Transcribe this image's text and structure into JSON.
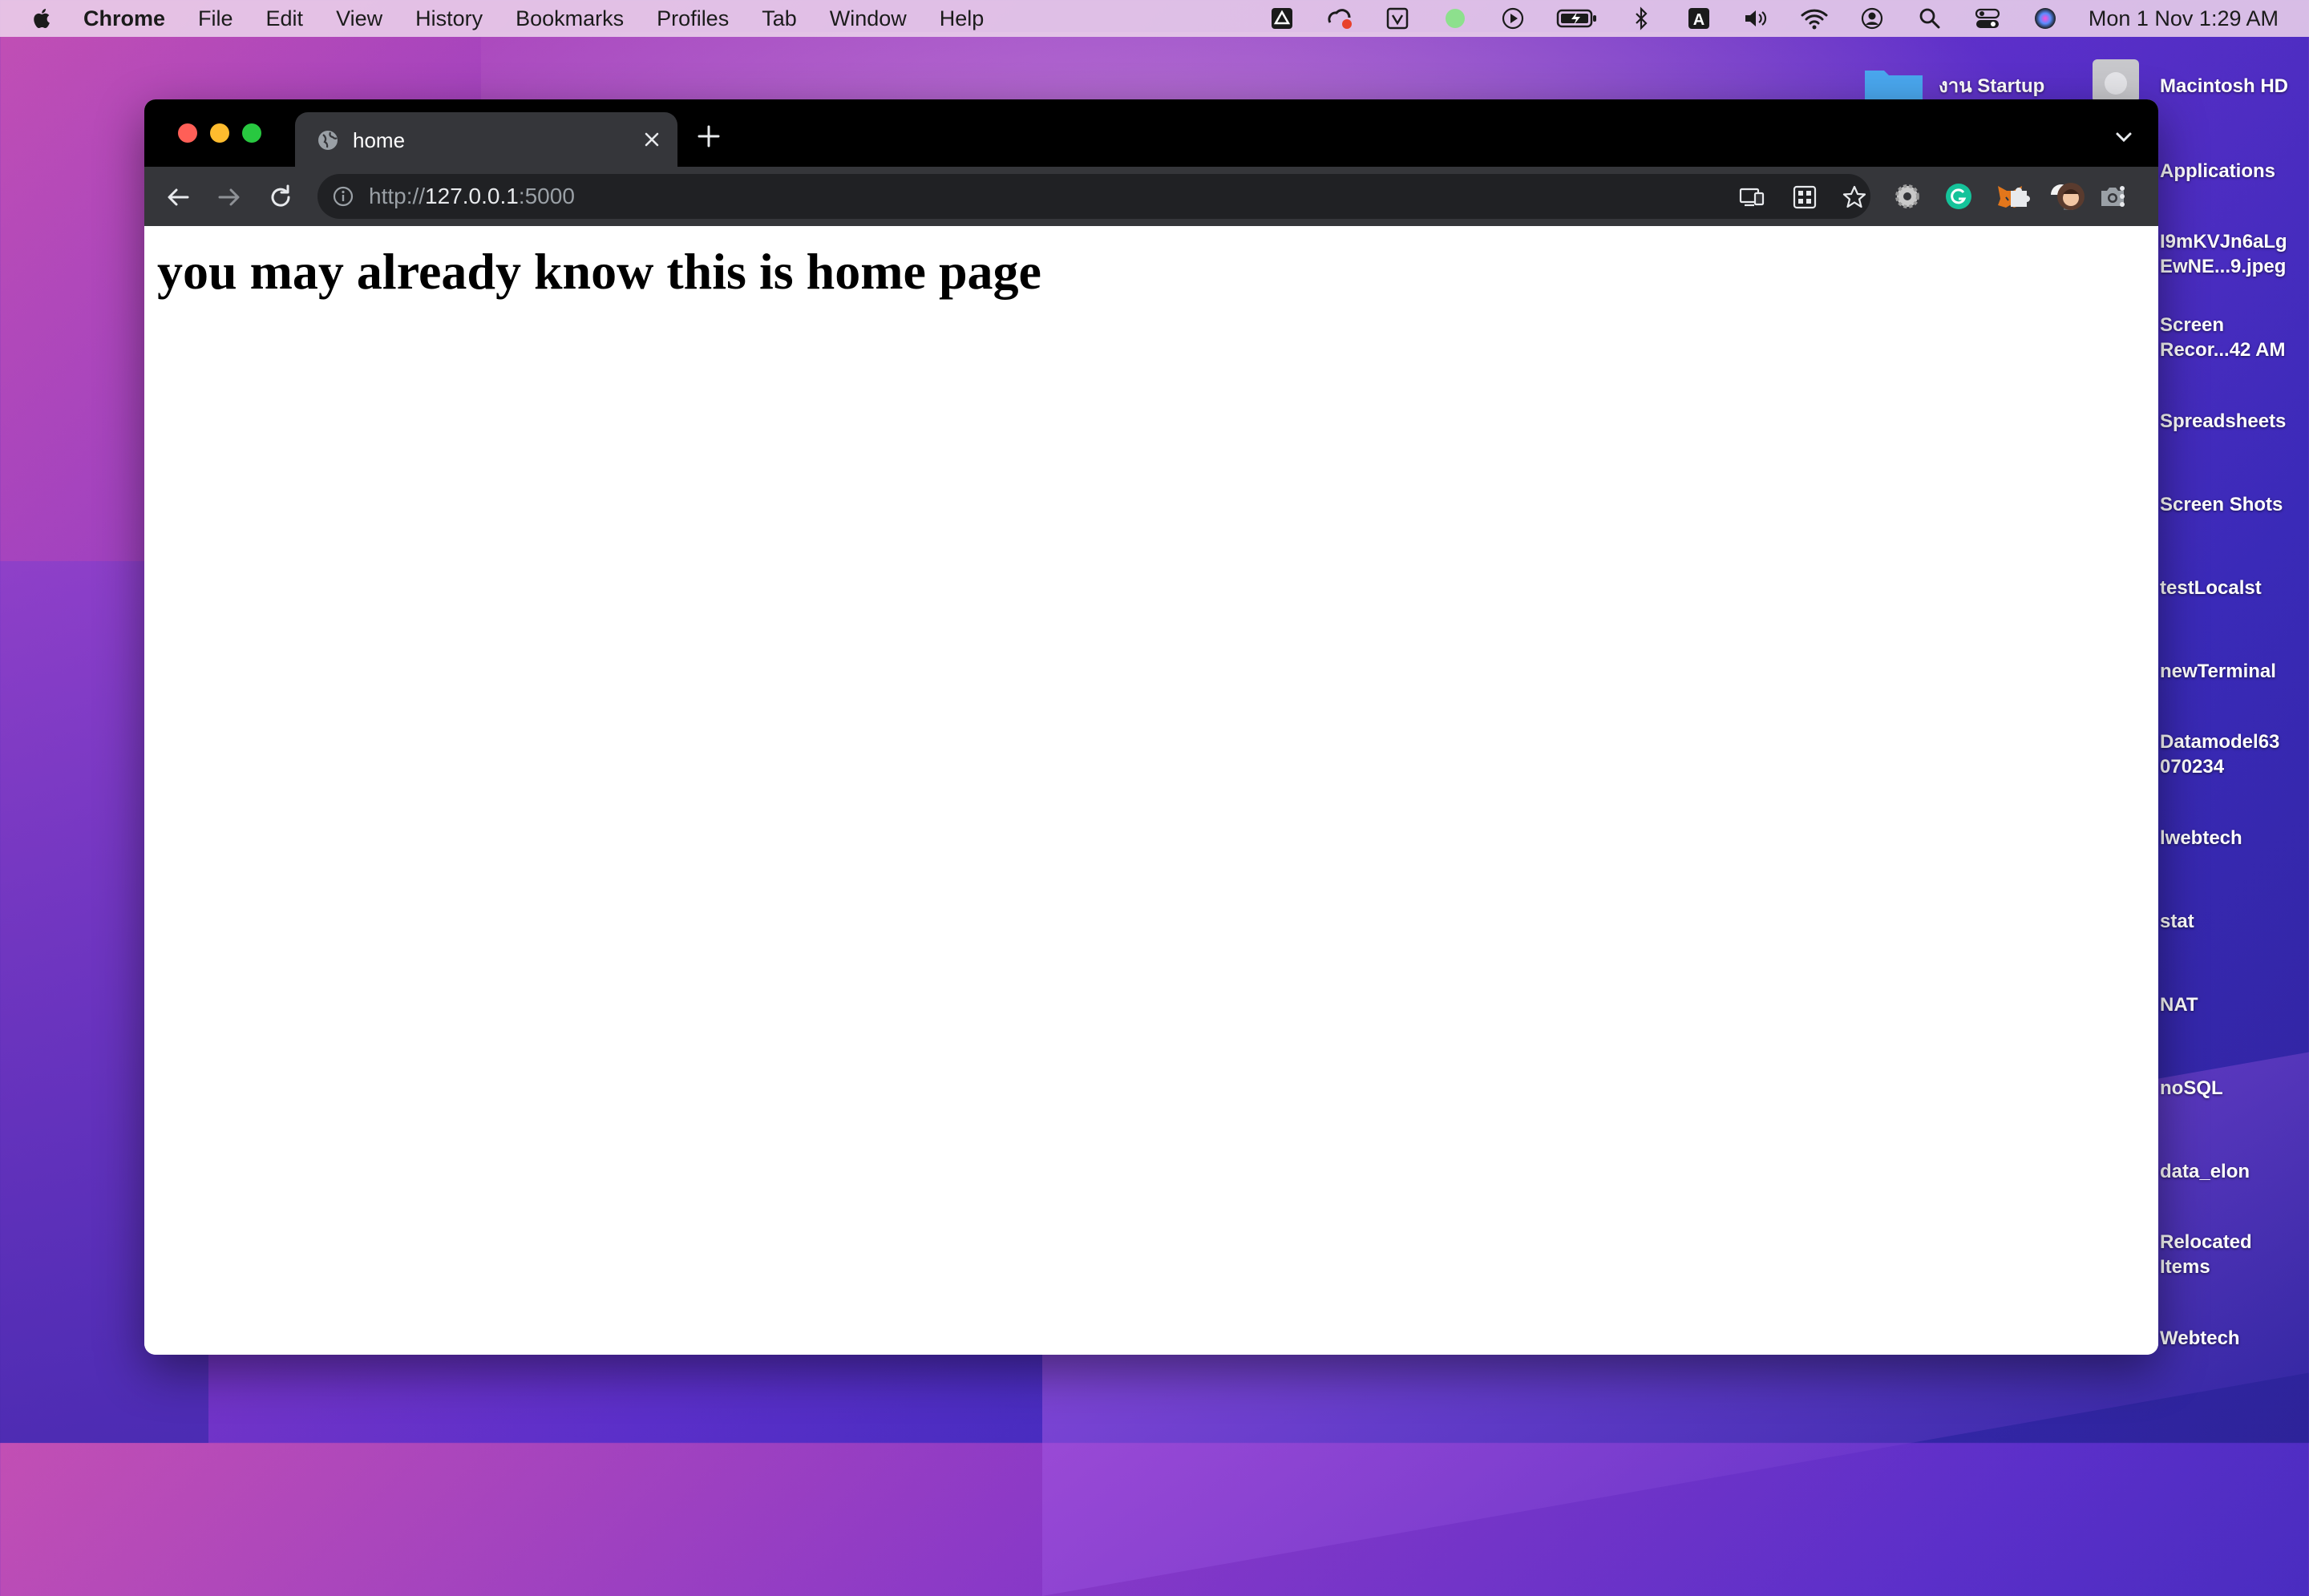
{
  "menubar": {
    "app_name": "Chrome",
    "items": [
      "File",
      "Edit",
      "View",
      "History",
      "Bookmarks",
      "Profiles",
      "Tab",
      "Window",
      "Help"
    ],
    "clock": "Mon 1 Nov  1:29 AM",
    "status_icons": [
      "drive-icon",
      "creative-cloud-icon",
      "vpn-icon",
      "green-dot-icon",
      "play-icon",
      "battery-icon",
      "bluetooth-icon",
      "input-source-icon",
      "volume-icon",
      "wifi-icon",
      "user-icon",
      "spotlight-icon",
      "control-center-icon",
      "siri-icon"
    ],
    "input_source_letter": "A"
  },
  "desktop": {
    "top_items": [
      "งาน Startup",
      "Macintosh HD"
    ],
    "items": [
      "Applications",
      "I9mKVJn6aLg\nEwNE...9.jpeg",
      "Screen\nRecor...42 AM",
      "Spreadsheets",
      "Screen Shots",
      "testLocalst",
      "newTerminal",
      "Datamodel63\n070234",
      "lwebtech",
      "stat",
      "NAT",
      "noSQL",
      "data_elon",
      "Relocated\nItems",
      "Webtech"
    ]
  },
  "browser": {
    "tab_title": "home",
    "url_scheme": "http://",
    "url_host": "127.0.0.1",
    "url_port": ":5000",
    "extensions": [
      "gear-extension-icon",
      "grammarly-icon",
      "metamask-icon",
      "color-picker-icon",
      "camera-icon",
      "puzzle-icon",
      "profile-avatar-icon"
    ]
  },
  "page": {
    "heading": "you may already know this is home page"
  },
  "colors": {
    "tabstrip": "#000000",
    "toolbar": "#35363a",
    "omnibox": "#202124",
    "close": "#ff5f57",
    "minimize": "#febc2e",
    "zoom": "#28c840"
  }
}
